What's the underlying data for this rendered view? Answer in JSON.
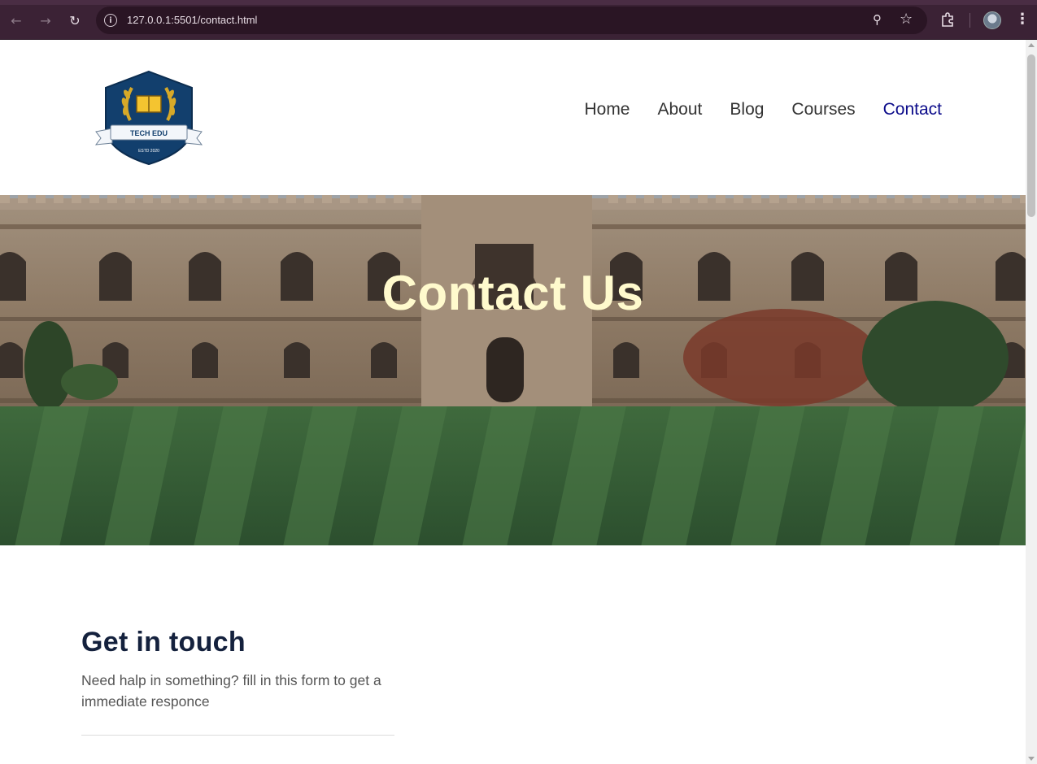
{
  "browser": {
    "url": "127.0.0.1:5501/contact.html"
  },
  "header": {
    "logo_text": "TECH EDU",
    "logo_sub": "ESTD 2020",
    "nav": [
      {
        "label": "Home"
      },
      {
        "label": "About"
      },
      {
        "label": "Blog"
      },
      {
        "label": "Courses"
      },
      {
        "label": "Contact"
      }
    ]
  },
  "hero": {
    "title": "Contact Us"
  },
  "contact": {
    "heading": "Get in touch",
    "description": "Need halp in something? fill in this form to get a immediate responce"
  },
  "icons": {
    "back": "arrow-left-icon",
    "forward": "arrow-right-icon",
    "reload": "reload-icon",
    "info": "info-icon",
    "zoom": "zoom-icon",
    "bookmark": "star-icon",
    "extensions": "puzzle-icon",
    "profile": "profile-icon",
    "menu": "kebab-menu-icon"
  },
  "colors": {
    "browser_bg": "#3b2235",
    "nav_active": "#0b0b8a",
    "hero_title": "#fffacd",
    "heading": "#14213d"
  }
}
